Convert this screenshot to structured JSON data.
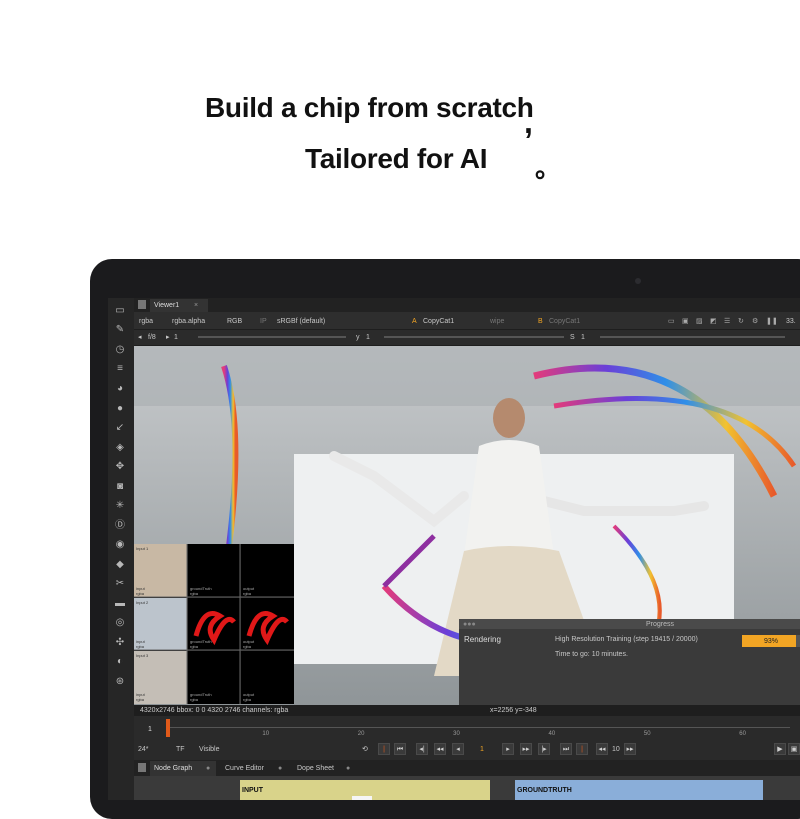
{
  "hero": {
    "line1": "Build a chip from scratch",
    "comma": ",",
    "line2": "Tailored for AI",
    "period": "。"
  },
  "viewer_tab": {
    "label": "Viewer1",
    "close": "×"
  },
  "toolbar1": {
    "channels": "rgba",
    "alpha": "rgba.alpha",
    "colorspace": "RGB",
    "ip": "IP",
    "lut": "sRGBf (default)",
    "a_label": "A",
    "a_input": "CopyCat1",
    "wipe": "wipe",
    "b_label": "B",
    "b_input": "CopyCat1",
    "zoom": "33."
  },
  "toolbar2": {
    "fstop": "f/8",
    "frame_in": "1",
    "y_label": "y",
    "y_val": "1",
    "s_label": "S",
    "s_val": "1"
  },
  "thumbnails": {
    "cells": [
      {
        "top": "Input 1",
        "bottom": "input\nrgba"
      },
      {
        "top": "",
        "bottom": "groundTruth\nrgba"
      },
      {
        "top": "",
        "bottom": "output\nrgba"
      },
      {
        "top": "Input 2",
        "bottom": "input\nrgba"
      },
      {
        "top": "",
        "bottom": "groundTruth\nrgba"
      },
      {
        "top": "",
        "bottom": "output\nrgba"
      },
      {
        "top": "Input 3",
        "bottom": "input\nrgba"
      },
      {
        "top": "",
        "bottom": "groundTruth\nrgba"
      },
      {
        "top": "",
        "bottom": "output\nrgba"
      }
    ]
  },
  "progress": {
    "title": "Progress",
    "label": "Rendering",
    "task": "High Resolution Training (step 19415 / 20000)",
    "eta": "Time to go: 10 minutes.",
    "percent_text": "93%",
    "percent": 0.93
  },
  "status": {
    "info": "4320x2746  bbox: 0 0 4320 2746 channels: rgba",
    "coords": "x=2256 y=-348"
  },
  "timeline": {
    "start": "1",
    "ticks": [
      "1",
      "10",
      "20",
      "30",
      "40",
      "50",
      "60"
    ]
  },
  "controls": {
    "fps": "24*",
    "tf": "TF",
    "visible": "Visible",
    "frame": "1",
    "step": "10"
  },
  "bottom_tabs": [
    "Node Graph",
    "Curve Editor",
    "Dope Sheet"
  ],
  "nodes": {
    "input": "INPUT",
    "groundtruth": "GROUNDTRUTH"
  },
  "colors": {
    "accent": "#f2a524",
    "frame_marker": "#e05a1a",
    "node_input": "#d9d38a",
    "node_gt": "#8aaed9"
  }
}
